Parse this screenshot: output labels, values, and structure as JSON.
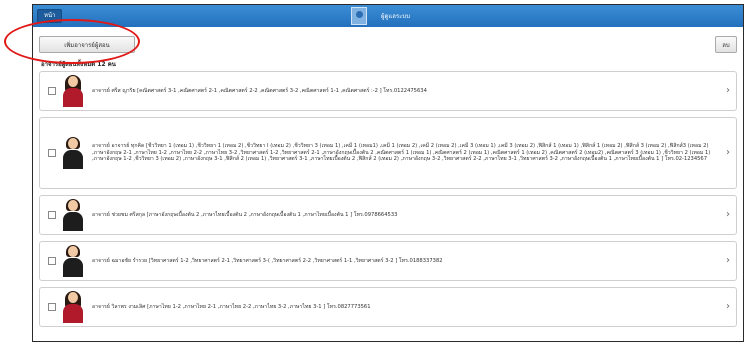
{
  "topbar": {
    "back_label": "หน้า",
    "title": "ผู้ดูแลระบบ"
  },
  "toolbar": {
    "add_label": "เพิ่มอาจารย์ผู้สอน",
    "delete_label": "ลบ"
  },
  "count_label": "อาจารย์ผู้สอนทั้งหมด 12 คน",
  "teachers": [
    {
      "text": "อาจารย์ ศรีส ญาริย [คณิตศาสตร์ 3-1 ,คณิตศาสตร์ 2-1 ,คณิตศาสตร์ 2-2 ,คณิตศาสตร์ 3-2 ,คณิตศาสตร์ 1-1 ,คณิตศาสตร์ :-2 ] โทร.0122475634",
      "gender": "female"
    },
    {
      "text": "อาจารย์ อาจารย์ ทุกคิด [ชีววิทยา 1 (เทอม 1) ,ชีววิทยา 1 (เทอม 2) ,ชีววิทยา I (เทอม 2) ,ชีววิทยา 3 (เทอม 1) ,เคมี 1 (เทอม1) ,เคมี 1 (เทอม 2) ,เคมี 2 (เทอม 2) ,เคมี 3 (เทอม 1) ,เคมี 3 (เทอม 2) ,ฟิสิกส์ 1 (เทอม 1) ,ฟิสิกส์ 1 (เทอม 2) ,ฟิสิกส์ 3 (เทอม 2) ,ฟิสิกส์3 (เทอม 2) ,ภาษาอังกฤษ 2-1 ,ภาษาไทย 1-2 ,ภาษาไทย 2-2 ,ภาษาไทย 3-2 ,วิทยาศาสตร์ 1-2 ,วิทยาศาสตร์ 2-1 ,ภาษาอังกฤษเบื้องต้น 2 ,คณิตศาสตร์ 1 (เทอม 1) ,คณิตศาสตร์ 2 (เทอม 1) ,คณิตศาสตร์ 1 (เทอม 2) ,คณิตศาสตร์ 2 (เทอม2) ,คณิตศาสตร์ 3 (เทอม 1) ,ชีววิทยา 2 (เทอม 1) ,ภาษาอังกฤษ 1-2 ,ชีววิทยา 3 (เทอม 2) ,ภาษาอังกฤษ 3-1 ,ฟิสิกส์ 2 (เทอม 1) ,วิทยาศาสตร์ 3-1 ,ภาษาไทยเบื้องต้น 2 ,ฟิสิกส์ 2 (เทอม 2) ,ภาษาอังกฤษ 3-2 ,วิทยาศาสตร์ 2-2 ,ภาษาไทย 3-1 ,วิทยาศาสตร์ 3-2 ,ภาษาอังกฤษเบื้องต้น 1 ,ภาษาไทยเบื้องต้น 1 ] โทร.02-1234567",
      "gender": "male"
    },
    {
      "text": "อาจารย์ ช่วยชม ศรีสกุล [ภาษาอังกฤษเบื้องต้น 2 ,ภาษาไทยเบื้องต้น 2 ,ภาษาอังกฤษเบื้องต้น 1 ,ภาษาไทยเบื้องต้น 1 ] โทร.0978664533",
      "gender": "male"
    },
    {
      "text": "อาจารย์ ฉมาอชัย รำรวย [วิทยาศาสตร์ 1-2 ,วิทยาศาสตร์ 2-1 ,วิทยาศาสตร์ 3-( ,วิทยาศาสตร์ 2-2 ,วิทยาศาสตร์ 1-1 ,วิทยาศาสตร์ 3-2 ] โทร.0188337382",
      "gender": "male"
    },
    {
      "text": "อาจารย์ วิลาพร งามเลิศ [ภาษาไทย 1-2 ,ภาษาไทย 2-1 ,ภาษาไทย 2-2 ,ภาษาไทย 3-2 ,ภาษาไทย 3-1 ] โทร.0827773561",
      "gender": "female"
    }
  ],
  "colors": {
    "header_blue": "#2370bd",
    "annotation_red": "#e01818"
  },
  "icons": {
    "row_action": "chevron-right-icon"
  }
}
